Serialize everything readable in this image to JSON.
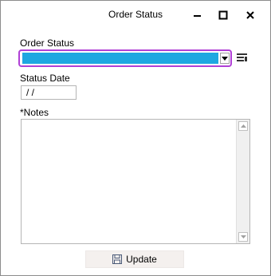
{
  "window": {
    "title": "Order Status",
    "minimize_icon": "minimize-icon",
    "maximize_icon": "maximize-icon",
    "close_icon": "close-icon"
  },
  "form": {
    "order_status": {
      "label": "Order Status",
      "value": "",
      "selected_color": "#1ea7e1",
      "focus_color": "#b040d6"
    },
    "status_date": {
      "label": "Status Date",
      "value": " / /"
    },
    "notes": {
      "label": "*Notes",
      "value": ""
    }
  },
  "actions": {
    "update_label": "Update",
    "update_icon": "save-icon"
  }
}
